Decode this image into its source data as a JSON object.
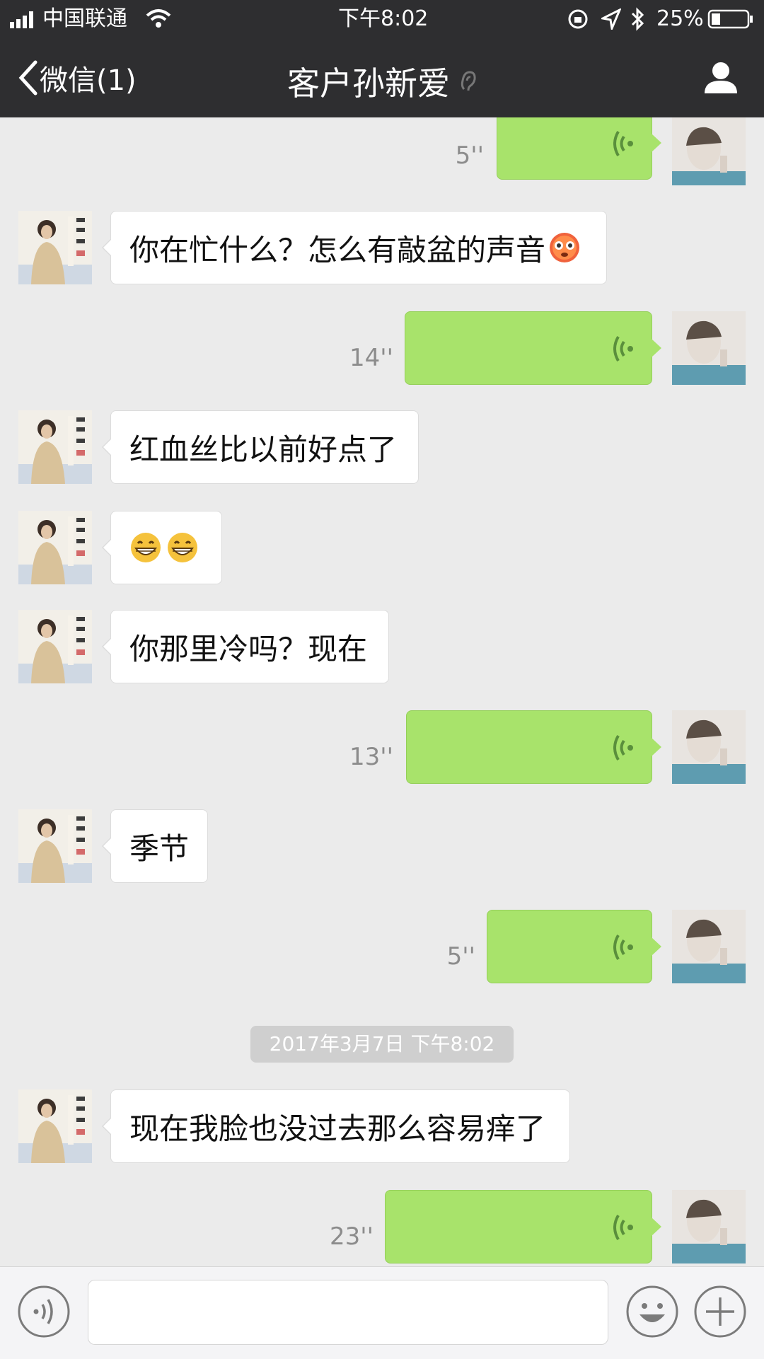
{
  "status_bar": {
    "carrier": "中国联通",
    "time": "下午8:02",
    "battery": "25%"
  },
  "nav": {
    "back_label": "微信(1)",
    "title": "客户孙新爱"
  },
  "messages": {
    "m1": {
      "duration": "5''"
    },
    "m2": {
      "text": "你在忙什么？怎么有敲盆的声音"
    },
    "m3": {
      "duration": "14''"
    },
    "m4": {
      "text": "红血丝比以前好点了"
    },
    "m5": {
      "text": ""
    },
    "m6": {
      "text": "你那里冷吗？现在"
    },
    "m7": {
      "duration": "13''"
    },
    "m8": {
      "text": "季节"
    },
    "m9": {
      "duration": "5''"
    },
    "m10": {
      "text": "现在我脸也没过去那么容易痒了"
    },
    "m11": {
      "duration": "23''"
    }
  },
  "timestamp": "2017年3月7日 下午8:02",
  "icons": {
    "emoji_blush": "flushed-face",
    "emoji_grin": "grinning-face",
    "voice": "voice-wave-icon"
  },
  "colors": {
    "header": "#2e2e30",
    "outgoing_bubble": "#a8e36b",
    "chat_bg": "#ebebeb"
  }
}
